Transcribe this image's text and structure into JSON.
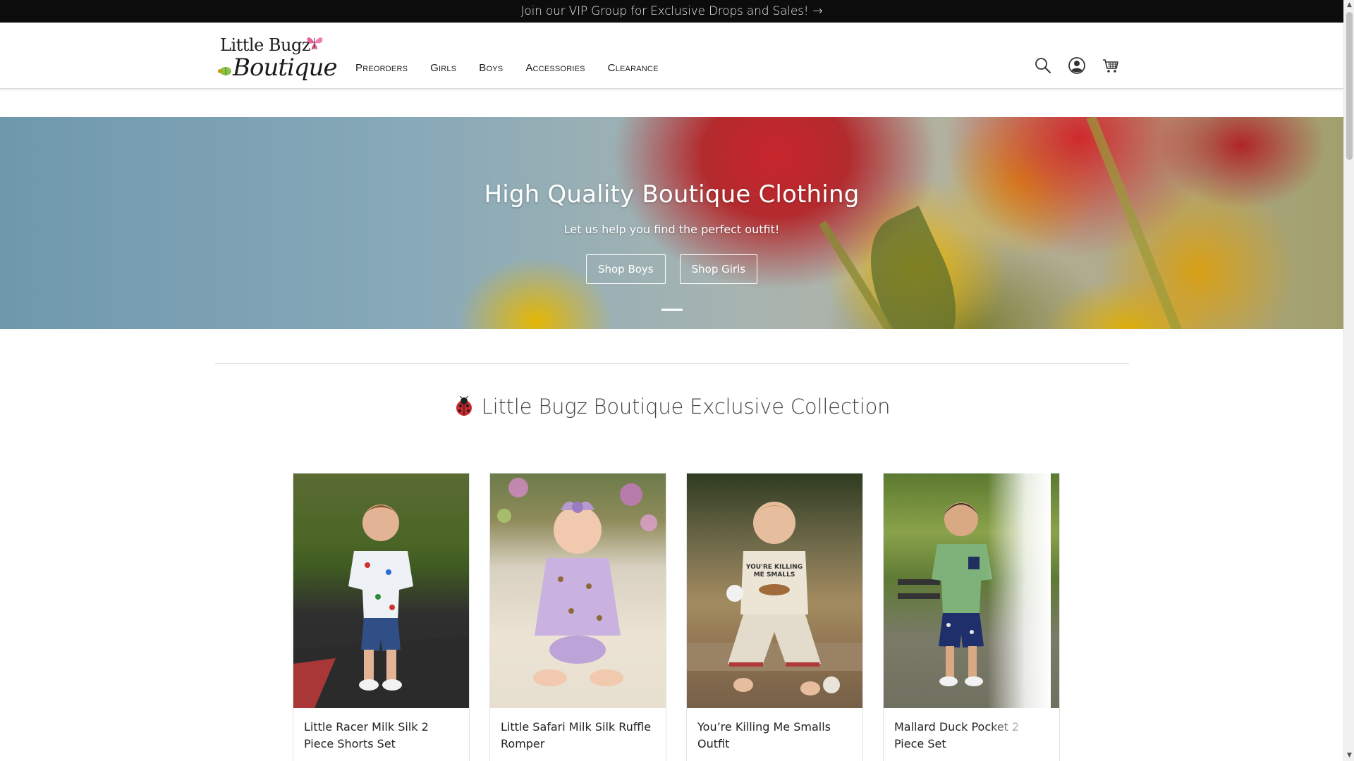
{
  "announcement": {
    "text": "Join our VIP Group for Exclusive Drops and Sales!",
    "arrow": "→"
  },
  "logo": {
    "line1": "Little Bugz",
    "line2": "Boutique"
  },
  "nav": {
    "items": [
      {
        "label": "Preorders"
      },
      {
        "label": "Girls"
      },
      {
        "label": "Boys"
      },
      {
        "label": "Accessories"
      },
      {
        "label": "Clearance"
      }
    ]
  },
  "header_icons": [
    "search-icon",
    "account-icon",
    "cart-icon"
  ],
  "hero": {
    "title": "High Quality Boutique Clothing",
    "subtitle": "Let us help you find the perfect outfit!",
    "buttons": [
      {
        "label": "Shop Boys"
      },
      {
        "label": "Shop Girls"
      }
    ]
  },
  "collection": {
    "title": "Little Bugz Boutique Exclusive Collection",
    "products": [
      {
        "name": "Little Racer Milk Silk 2 Piece Shorts Set"
      },
      {
        "name": "Little Safari Milk Silk Ruffle Romper"
      },
      {
        "name": "You’re Killing Me Smalls Outfit"
      },
      {
        "name": "Mallard Duck Pocket 2 Piece Set"
      }
    ],
    "shirt_text": "YOU'RE KILLING ME SMALLS"
  },
  "colors": {
    "announcement_bg": "#0c0c0c",
    "header_bg": "#ffffff",
    "hero_text": "#ffffff",
    "section_title": "#444444"
  }
}
